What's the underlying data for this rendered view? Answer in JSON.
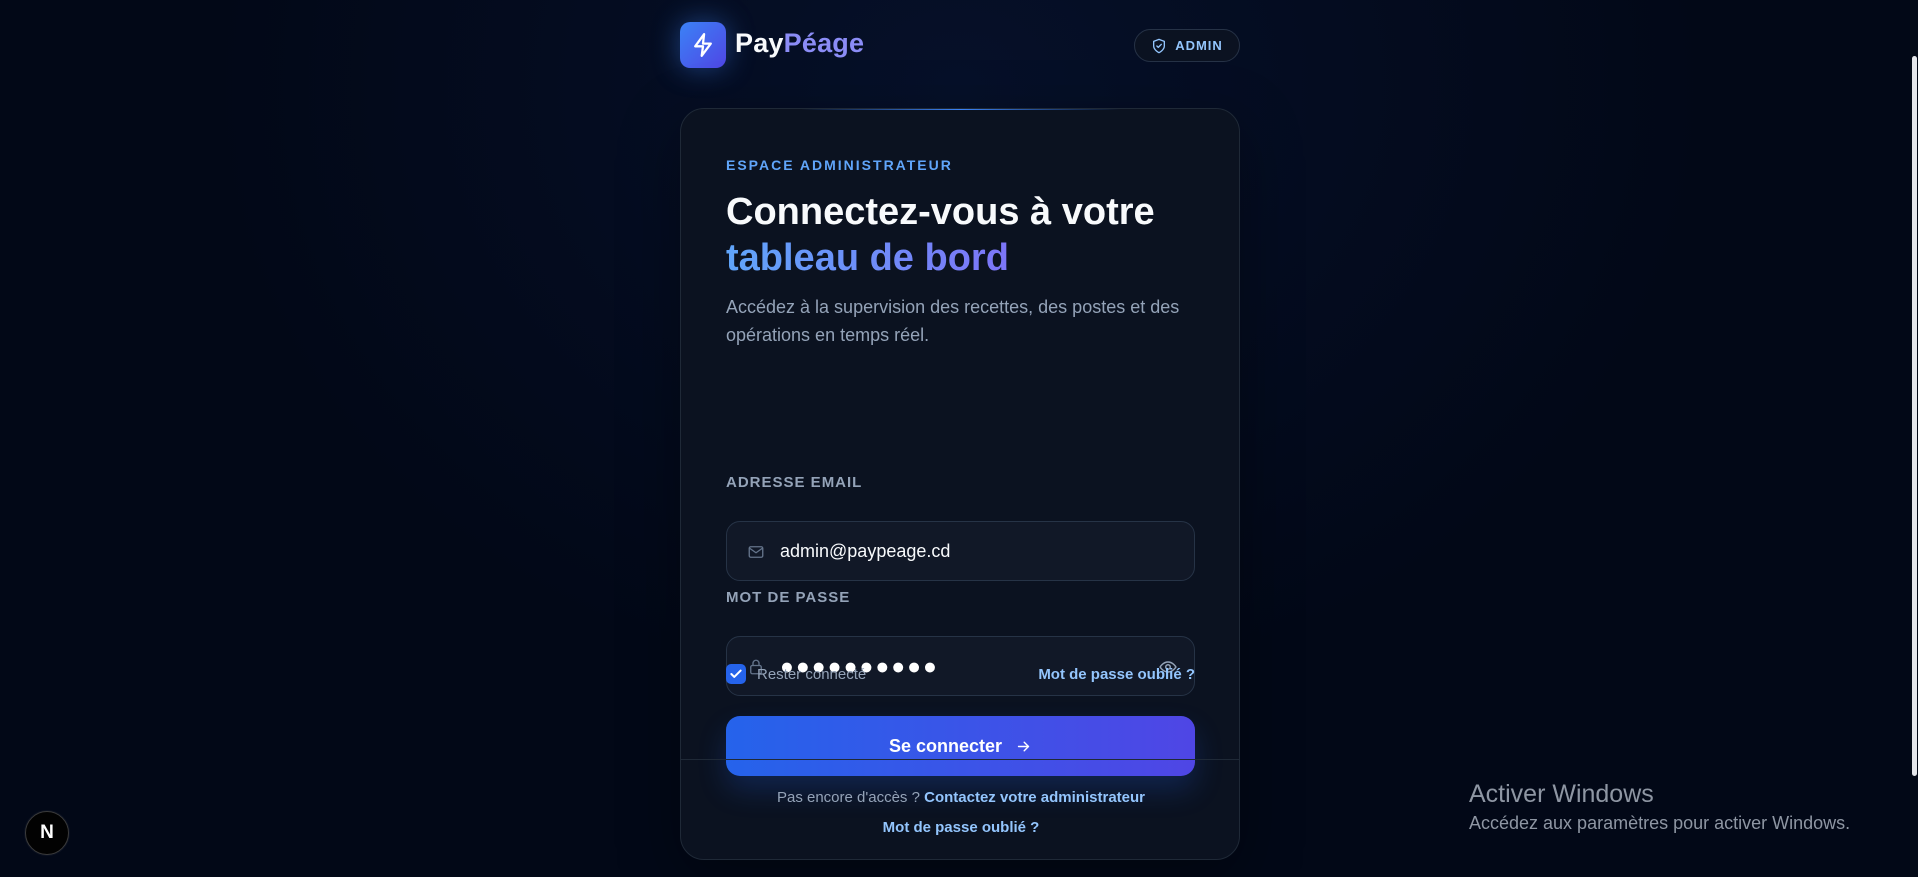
{
  "brand": {
    "name_primary": "Pay",
    "name_secondary": "Péage",
    "logo_icon": "lightning-bolt-icon"
  },
  "header": {
    "admin_badge": {
      "label": "ADMIN",
      "icon": "shield-check-icon"
    }
  },
  "login": {
    "kicker": "ESPACE ADMINISTRATEUR",
    "title_primary": "Connectez-vous à votre",
    "title_accent": "tableau de bord",
    "subtitle": "Accédez à la supervision des recettes, des postes et des opérations en temps réel.",
    "email": {
      "label": "ADRESSE EMAIL",
      "value": "admin@paypeage.cd",
      "icon": "mail-icon"
    },
    "password": {
      "label": "MOT DE PASSE",
      "value": "●●●●●●●●●●",
      "icon": "lock-icon",
      "toggle_icon": "eye-icon"
    },
    "remember": {
      "label": "Rester connecté",
      "checked": true
    },
    "forgot_password": "Mot de passe oublié ?",
    "submit": {
      "label": "Se connecter",
      "icon": "arrow-right-icon"
    },
    "footer": {
      "prompt": "Pas encore d'accès ?",
      "contact_link": "Contactez votre administrateur",
      "forgot_link": "Mot de passe oublié ?"
    }
  },
  "system": {
    "next_badge": "N",
    "windows_activation_title": "Activer Windows",
    "windows_activation_subtitle": "Accédez aux paramètres pour activer Windows."
  },
  "colors": {
    "background": "#020817",
    "card": "#0b1220",
    "accent_blue": "#2563eb",
    "accent_violet": "#4f46e5",
    "link": "#93c5fd"
  }
}
